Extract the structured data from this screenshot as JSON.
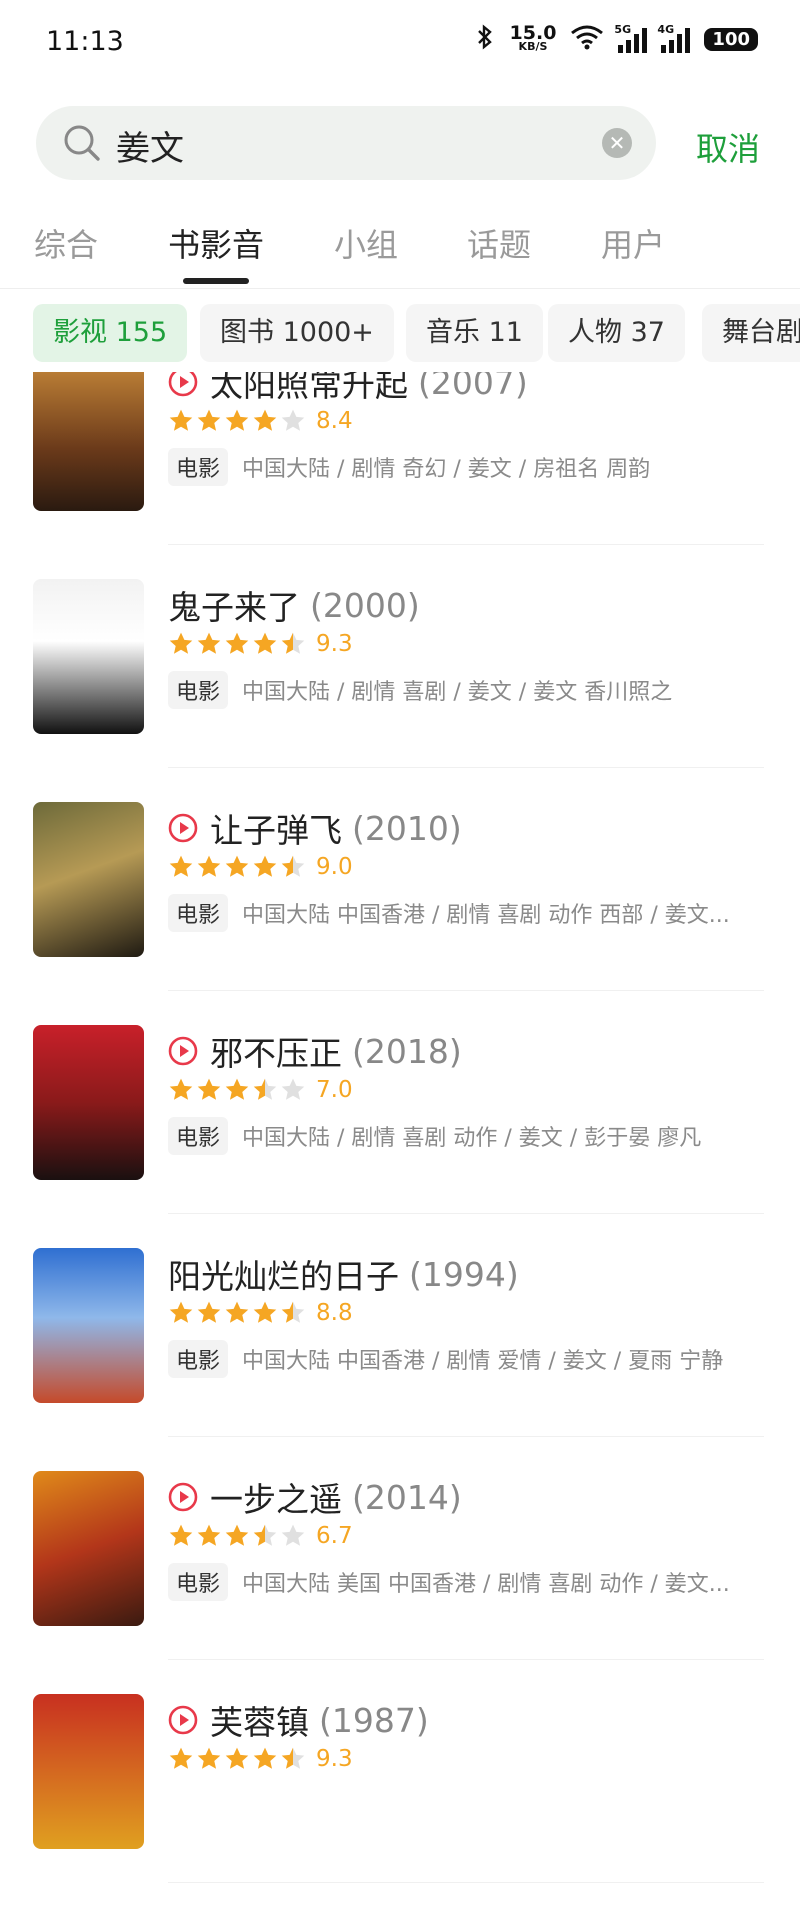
{
  "status_bar": {
    "time": "11:13",
    "net_speed": "15.0",
    "net_unit": "KB/S",
    "sig1": "5G",
    "sig2": "4G",
    "battery": "100"
  },
  "search": {
    "query": "姜文",
    "cancel": "取消"
  },
  "tabs": [
    "综合",
    "书影音",
    "小组",
    "话题",
    "用户"
  ],
  "active_tab": "书影音",
  "filters": [
    "影视 155",
    "图书 1000+",
    "音乐 11",
    "人物 37",
    "舞台剧"
  ],
  "results": [
    {
      "title": "太阳照常升起",
      "year": "(2007)",
      "playable": true,
      "rating": 8.4,
      "stars": 4,
      "type": "电影",
      "info": "中国大陆 / 剧情 奇幻 / 姜文 / 房祖名 周韵"
    },
    {
      "title": "鬼子来了",
      "year": "(2000)",
      "playable": false,
      "rating": 9.3,
      "stars": 4.5,
      "type": "电影",
      "info": "中国大陆 / 剧情 喜剧 / 姜文 / 姜文 香川照之"
    },
    {
      "title": "让子弹飞",
      "year": "(2010)",
      "playable": true,
      "rating": 9.0,
      "stars": 4.5,
      "type": "电影",
      "info": "中国大陆 中国香港 / 剧情 喜剧 动作 西部 / 姜文..."
    },
    {
      "title": "邪不压正",
      "year": "(2018)",
      "playable": true,
      "rating": 7.0,
      "stars": 3.5,
      "type": "电影",
      "info": "中国大陆 / 剧情 喜剧 动作 / 姜文 / 彭于晏 廖凡"
    },
    {
      "title": "阳光灿烂的日子",
      "year": "(1994)",
      "playable": false,
      "rating": 8.8,
      "stars": 4.5,
      "type": "电影",
      "info": "中国大陆 中国香港 / 剧情 爱情 / 姜文 / 夏雨 宁静"
    },
    {
      "title": "一步之遥",
      "year": "(2014)",
      "playable": true,
      "rating": 6.7,
      "stars": 3.5,
      "type": "电影",
      "info": "中国大陆 美国 中国香港 / 剧情 喜剧 动作 / 姜文..."
    },
    {
      "title": "芙蓉镇",
      "year": "(1987)",
      "playable": true,
      "rating": 9.3,
      "stars": 4.5,
      "type": "电影",
      "info": ""
    }
  ],
  "colors": {
    "accent": "#1e9f3b",
    "star": "#f5a623",
    "play": "#e8394a"
  }
}
